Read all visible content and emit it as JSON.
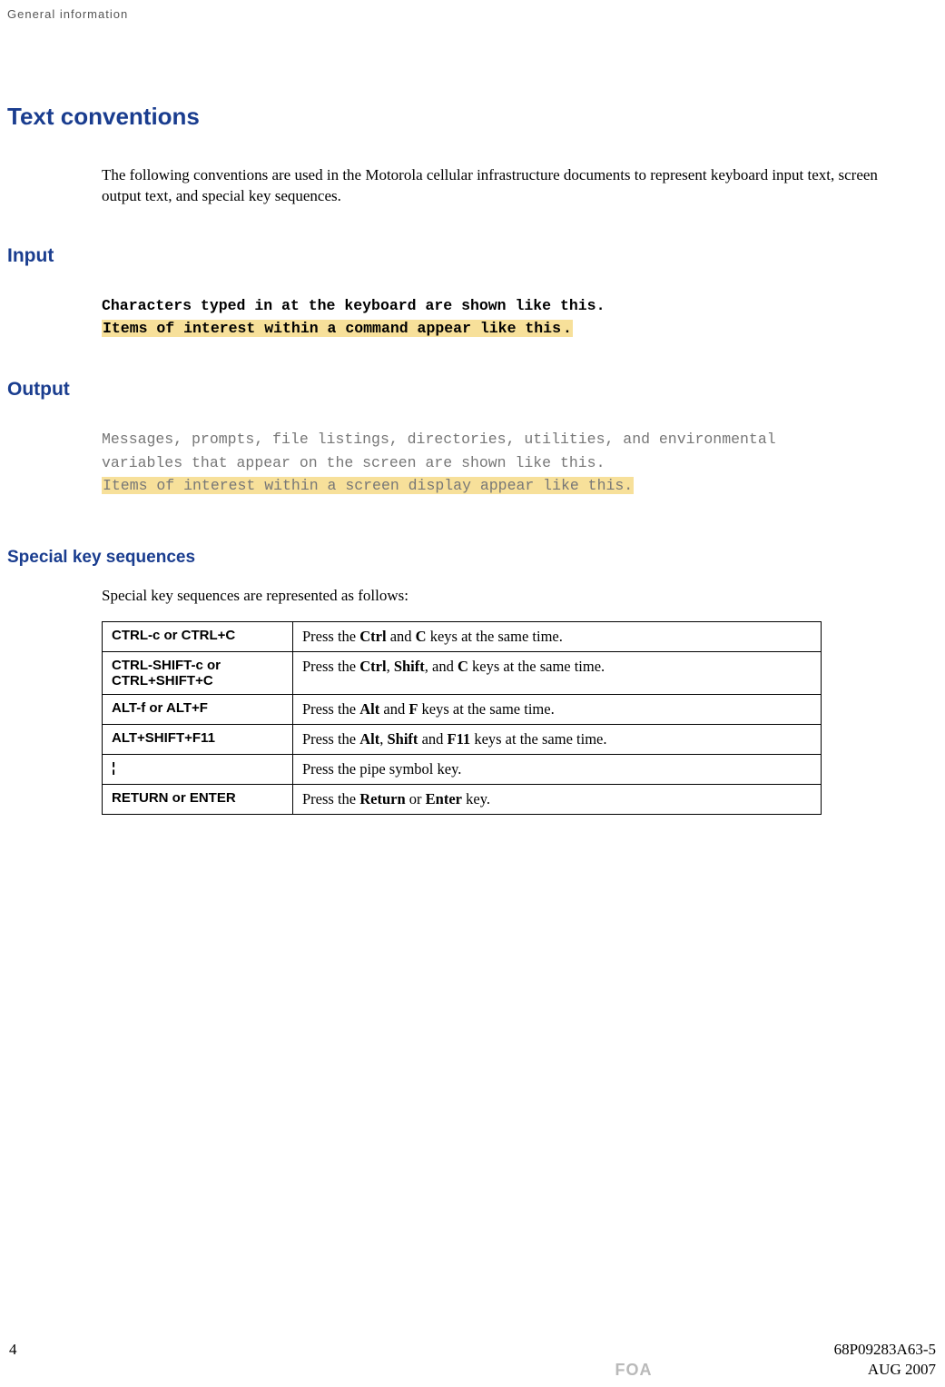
{
  "header": {
    "running": "General  information"
  },
  "title": "Text conventions",
  "intro": "The following conventions are used in the Motorola cellular infrastructure documents to represent keyboard input text, screen output text, and special key sequences.",
  "sections": {
    "input": {
      "heading": "Input",
      "line1": "Characters typed in at the keyboard are shown like this",
      "line1_tail": ".",
      "line2": "Items of interest within a command appear like this",
      "line2_tail": "."
    },
    "output": {
      "heading": "Output",
      "line1": "Messages, prompts, file listings, directories, utilities, and environmental",
      "line2": "variables that appear on the screen are shown like this.",
      "line3": "Items of interest within a screen display appear like this."
    },
    "special": {
      "heading": "Special key sequences",
      "intro": "Special key sequences are represented as follows:",
      "rows": [
        {
          "key": "CTRL-c or CTRL+C",
          "d1": "Press the ",
          "b1": "Ctrl",
          "d2": " and ",
          "b2": "C",
          "d3": " keys at the same time."
        },
        {
          "key": "CTRL-SHIFT-c or CTRL+SHIFT+C",
          "d1": "Press the ",
          "b1": "Ctrl",
          "d2": ", ",
          "b2": "Shift",
          "d3": ", and ",
          "b3": "C",
          "d4": " keys at the same time."
        },
        {
          "key": "ALT-f or ALT+F",
          "d1": "Press the ",
          "b1": "Alt",
          "d2": " and ",
          "b2": "F",
          "d3": " keys at the same time."
        },
        {
          "key": "ALT+SHIFT+F11",
          "d1": "Press the ",
          "b1": "Alt",
          "d2": ", ",
          "b2": "Shift",
          "d3": " and ",
          "b3": "F11",
          "d4": " keys at the same time."
        },
        {
          "key": "¦",
          "d1": "Press the pipe symbol key."
        },
        {
          "key": "RETURN or ENTER",
          "d1": "Press the ",
          "b1": "Return",
          "d2": " or ",
          "b2": "Enter",
          "d3": " key."
        }
      ]
    }
  },
  "footer": {
    "page": "4",
    "docnum": "68P09283A63-5",
    "center": "FOA",
    "date": "AUG 2007"
  }
}
